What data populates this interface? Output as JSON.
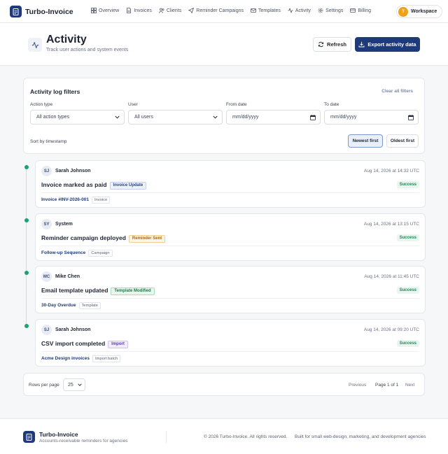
{
  "app": {
    "name": "Turbo-Invoice"
  },
  "nav": {
    "items": [
      {
        "label": "Overview",
        "icon": "grid-icon"
      },
      {
        "label": "Invoices",
        "icon": "file-icon"
      },
      {
        "label": "Clients",
        "icon": "users-icon"
      },
      {
        "label": "Reminder Campaigns",
        "icon": "send-icon"
      },
      {
        "label": "Templates",
        "icon": "mail-icon"
      },
      {
        "label": "Activity",
        "icon": "activity-icon"
      },
      {
        "label": "Settings",
        "icon": "gear-icon"
      },
      {
        "label": "Billing",
        "icon": "card-icon"
      }
    ],
    "workspace": {
      "initial": "T",
      "label": "Workspace"
    }
  },
  "header": {
    "title": "Activity",
    "subtitle": "Track user actions and system events",
    "refresh_label": "Refresh",
    "export_label": "Export activity data"
  },
  "filters": {
    "title": "Activity log filters",
    "clear_label": "Clear all filters",
    "action_type": {
      "label": "Action type",
      "value": "All action types"
    },
    "user": {
      "label": "User",
      "value": "All users"
    },
    "from_date": {
      "label": "From date",
      "placeholder": "mm/dd/yyyy"
    },
    "to_date": {
      "label": "To date",
      "placeholder": "mm/dd/yyyy"
    },
    "sort_label": "Sort by timestamp",
    "newest_label": "Newest first",
    "oldest_label": "Oldest first"
  },
  "events": [
    {
      "initials": "SJ",
      "user": "Sarah Johnson",
      "time": "Aug 14, 2026 at 14:32 UTC",
      "title": "Invoice marked as paid",
      "badge": "Invoice Update",
      "status": "Success",
      "link": "Invoice #INV-2026-001",
      "kind": "Invoice"
    },
    {
      "initials": "SY",
      "user": "System",
      "time": "Aug 14, 2026 at 13:15 UTC",
      "title": "Reminder campaign deployed",
      "badge": "Reminder Sent",
      "status": "Success",
      "link": "Follow-up Sequence",
      "kind": "Campaign"
    },
    {
      "initials": "MC",
      "user": "Mike Chen",
      "time": "Aug 14, 2026 at 11:45 UTC",
      "title": "Email template updated",
      "badge": "Template Modified",
      "status": "Success",
      "link": "30-Day Overdue",
      "kind": "Template"
    },
    {
      "initials": "SJ",
      "user": "Sarah Johnson",
      "time": "Aug 14, 2026 at 09:20 UTC",
      "title": "CSV import completed",
      "badge": "Import",
      "status": "Success",
      "link": "Acme Design invoices",
      "kind": "Import batch"
    }
  ],
  "pagination": {
    "rows_label": "Rows per page",
    "rows_value": "25",
    "prev_label": "Previous",
    "page_info": "Page 1 of 1",
    "next_label": "Next"
  },
  "footer": {
    "name": "Turbo-Invoice",
    "tagline": "Accounts-receivable reminders for agencies",
    "copyright": "© 2026 Turbo-Invoice. All rights reserved.",
    "built_for": "Built for small web-design, marketing, and development agencies"
  }
}
